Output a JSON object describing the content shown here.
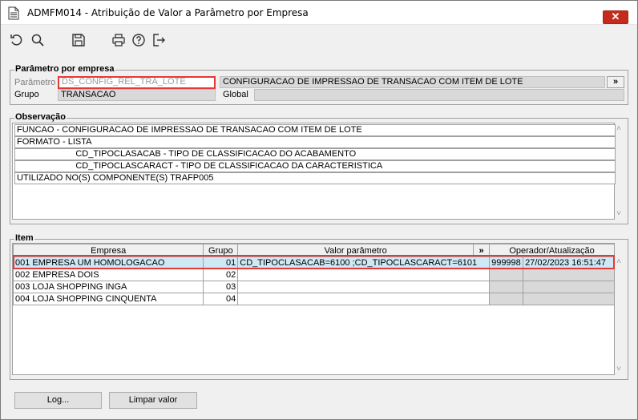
{
  "window": {
    "title": "ADMFM014 - Atribuição de Valor a Parâmetro por Empresa",
    "close_label": "✕"
  },
  "toolbar": {
    "icons": [
      "undo-icon",
      "search-icon",
      "save-icon",
      "print-icon",
      "help-icon",
      "exit-icon"
    ]
  },
  "parametro_empresa": {
    "title": "Parâmetro por empresa",
    "parametro_label": "Parâmetro",
    "parametro_value": "DS_CONFIG_REL_TRA_LOTE",
    "parametro_desc": "CONFIGURACAO DE IMPRESSAO DE TRANSACAO COM ITEM DE LOTE",
    "expand_label": "»",
    "grupo_label": "Grupo",
    "grupo_value": "TRANSACAO",
    "global_label": "Global",
    "global_value": ""
  },
  "observacao": {
    "title": "Observação",
    "lines": [
      "FUNCAO - CONFIGURACAO DE IMPRESSAO DE TRANSACAO COM ITEM DE LOTE",
      "FORMATO - LISTA",
      "                        CD_TIPOCLASACAB - TIPO DE CLASSIFICACAO DO ACABAMENTO",
      "                        CD_TIPOCLASCARACT - TIPO DE CLASSIFICACAO DA CARACTERISTICA",
      "UTILIZADO NO(S) COMPONENTE(S) TRAFP005"
    ]
  },
  "item": {
    "title": "Item",
    "headers": {
      "empresa": "Empresa",
      "grupo": "Grupo",
      "valor": "Valor parâmetro",
      "expand": "»",
      "operador": "Operador/Atualização"
    },
    "rows": [
      {
        "code": "001",
        "empresa": "EMPRESA UM HOMOLOGACAO",
        "grupo": "01",
        "valor": "CD_TIPOCLASACAB=6100 ;CD_TIPOCLASCARACT=6101",
        "operador": "999998",
        "data": "27/02/2023 16:51:47"
      },
      {
        "code": "002",
        "empresa": "EMPRESA DOIS",
        "grupo": "02",
        "valor": "",
        "operador": "",
        "data": ""
      },
      {
        "code": "003",
        "empresa": "LOJA SHOPPING INGA",
        "grupo": "03",
        "valor": "",
        "operador": "",
        "data": ""
      },
      {
        "code": "004",
        "empresa": "LOJA SHOPPING CINQUENTA",
        "grupo": "04",
        "valor": "",
        "operador": "",
        "data": ""
      }
    ]
  },
  "buttons": {
    "log": "Log...",
    "limpar": "Limpar valor"
  },
  "colors": {
    "highlight": "#e53935",
    "close": "#c42b1c",
    "selected_row": "#cfe8f6"
  }
}
